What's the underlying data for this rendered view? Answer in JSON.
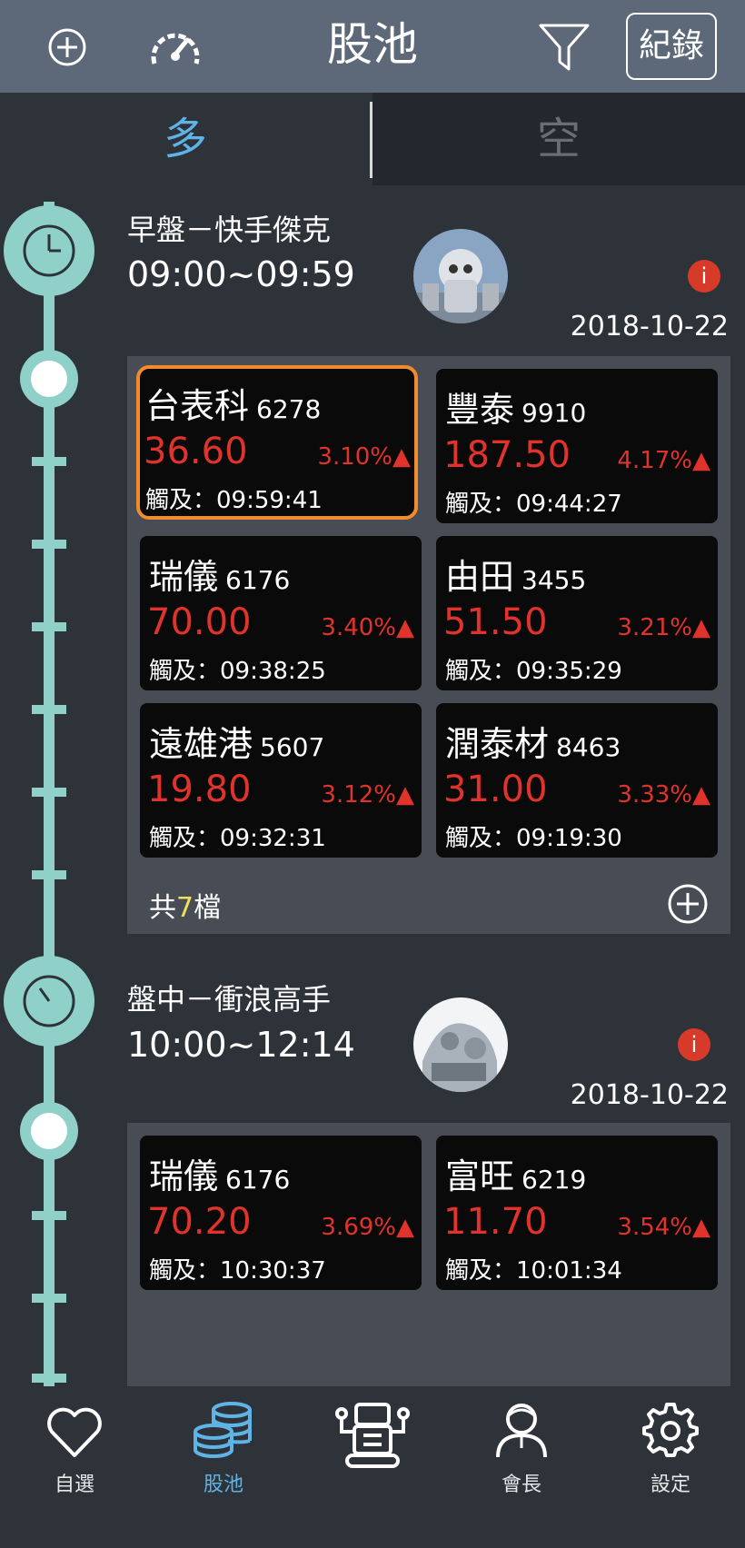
{
  "header": {
    "title": "股池",
    "record_label": "紀錄",
    "icons": [
      "add-circle-icon",
      "speedometer-icon",
      "filter-icon"
    ]
  },
  "tabs": [
    {
      "label": "多",
      "active": true
    },
    {
      "label": "空",
      "active": false
    }
  ],
  "periods": [
    {
      "title": "早盤－快手傑克",
      "time_range": "09:00~09:59",
      "info_icon": "i",
      "date": "2018-10-22",
      "cards": [
        {
          "name": "台表科",
          "code": "6278",
          "price": "36.60",
          "change": "3.10%▲",
          "touched": "觸及：09:59:41",
          "selected": true
        },
        {
          "name": "豐泰",
          "code": "9910",
          "price": "187.50",
          "change": "4.17%▲",
          "touched": "觸及：09:44:27"
        },
        {
          "name": "瑞儀",
          "code": "6176",
          "price": "70.00",
          "change": "3.40%▲",
          "touched": "觸及：09:38:25"
        },
        {
          "name": "由田",
          "code": "3455",
          "price": "51.50",
          "change": "3.21%▲",
          "touched": "觸及：09:35:29"
        },
        {
          "name": "遠雄港",
          "code": "5607",
          "price": "19.80",
          "change": "3.12%▲",
          "touched": "觸及：09:32:31"
        },
        {
          "name": "潤泰材",
          "code": "8463",
          "price": "31.00",
          "change": "3.33%▲",
          "touched": "觸及：09:19:30"
        }
      ],
      "count_prefix": "共",
      "count_number": "7",
      "count_suffix": "檔"
    },
    {
      "title": "盤中－衝浪高手",
      "time_range": "10:00~12:14",
      "info_icon": "i",
      "date": "2018-10-22",
      "cards": [
        {
          "name": "瑞儀",
          "code": "6176",
          "price": "70.20",
          "change": "3.69%▲",
          "touched": "觸及：10:30:37"
        },
        {
          "name": "富旺",
          "code": "6219",
          "price": "11.70",
          "change": "3.54%▲",
          "touched": "觸及：10:01:34"
        }
      ]
    }
  ],
  "bottom_nav": [
    {
      "label": "自選",
      "icon": "heart-icon",
      "active": false
    },
    {
      "label": "股池",
      "icon": "coins-stack-icon",
      "active": true
    },
    {
      "label": "",
      "icon": "robot-icon",
      "active": false
    },
    {
      "label": "會長",
      "icon": "person-icon",
      "active": false
    },
    {
      "label": "設定",
      "icon": "gear-icon",
      "active": false
    }
  ],
  "colors": {
    "header_bg": "#5d6878",
    "accent_blue": "#5fb4e6",
    "timeline_teal": "#8fd1c9",
    "price_red": "#e0332b",
    "selected_border": "#f18b2b",
    "count_yellow": "#f2e05a"
  }
}
